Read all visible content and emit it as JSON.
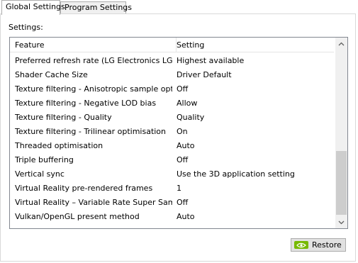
{
  "tabs": [
    {
      "label": "Global Settings",
      "active": true
    },
    {
      "label": "Program Settings",
      "active": false
    }
  ],
  "settings_label": "Settings:",
  "columns": {
    "feature": "Feature",
    "setting": "Setting"
  },
  "rows": [
    {
      "feature": "Preferred refresh rate (LG Electronics LG ...",
      "setting": "Highest available"
    },
    {
      "feature": "Shader Cache Size",
      "setting": "Driver Default"
    },
    {
      "feature": "Texture filtering - Anisotropic sample opti...",
      "setting": "Off"
    },
    {
      "feature": "Texture filtering - Negative LOD bias",
      "setting": "Allow"
    },
    {
      "feature": "Texture filtering - Quality",
      "setting": "Quality"
    },
    {
      "feature": "Texture filtering - Trilinear optimisation",
      "setting": "On"
    },
    {
      "feature": "Threaded optimisation",
      "setting": "Auto"
    },
    {
      "feature": "Triple buffering",
      "setting": "Off"
    },
    {
      "feature": "Vertical sync",
      "setting": "Use the 3D application setting"
    },
    {
      "feature": "Virtual Reality pre-rendered frames",
      "setting": "1"
    },
    {
      "feature": "Virtual Reality – Variable Rate Super Samp...",
      "setting": "Off"
    },
    {
      "feature": "Vulkan/OpenGL present method",
      "setting": "Auto"
    }
  ],
  "restore_button": {
    "label": "Restore",
    "icon": "nvidia-logo-icon"
  },
  "colors": {
    "nvidia_green": "#76b900",
    "scroll_thumb": "#cdcdcd"
  }
}
